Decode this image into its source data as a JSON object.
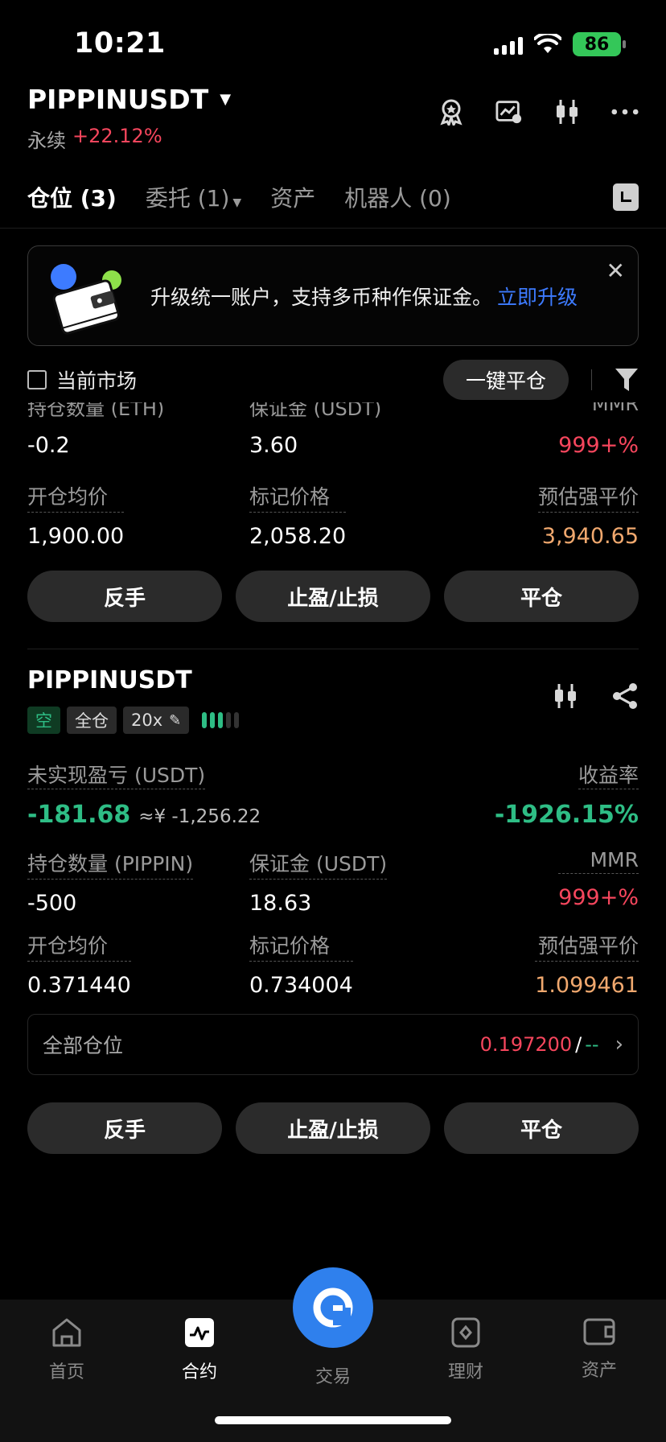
{
  "status_bar": {
    "time": "10:21",
    "battery": "86"
  },
  "header": {
    "pair": "PIPPINUSDT",
    "market_type": "永续",
    "change": "+22.12%"
  },
  "tabs": [
    {
      "label": "仓位 (3)"
    },
    {
      "label": "委托 (1)"
    },
    {
      "label": "资产"
    },
    {
      "label": "机器人 (0)"
    }
  ],
  "banner": {
    "text": "升级统一账户，支持多币种作保证金。",
    "link": "立即升级"
  },
  "filter": {
    "current_market": "当前市场",
    "close_all": "一键平仓"
  },
  "position1": {
    "cut_labels": [
      "持仓数量 (ETH)",
      "保证金 (USDT)",
      "MMR"
    ],
    "qty": "-0.2",
    "margin": "3.60",
    "mmr": "999+%",
    "entry_label": "开仓均价",
    "entry": "1,900.00",
    "mark_label": "标记价格",
    "mark": "2,058.20",
    "liq_label": "预估强平价",
    "liq": "3,940.65",
    "buttons": [
      "反手",
      "止盈/止损",
      "平仓"
    ]
  },
  "position2": {
    "pair": "PIPPINUSDT",
    "side": "空",
    "margin_mode": "全仓",
    "leverage": "20x",
    "pnl_label": "未实现盈亏 (USDT)",
    "pnl": "-181.68",
    "pnl_cny": "≈¥ -1,256.22",
    "roe_label": "收益率",
    "roe": "-1926.15%",
    "qty_label": "持仓数量 (PIPPIN)",
    "qty": "-500",
    "margin_label": "保证金 (USDT)",
    "margin": "18.63",
    "mmr_label": "MMR",
    "mmr": "999+%",
    "entry_label": "开仓均价",
    "entry": "0.371440",
    "mark_label": "标记价格",
    "mark": "0.734004",
    "liq_label": "预估强平价",
    "liq": "1.099461",
    "all_positions_label": "全部仓位",
    "all_positions_liq": "0.197200",
    "all_positions_sep": "/",
    "all_positions_dash": "--",
    "buttons": [
      "反手",
      "止盈/止损",
      "平仓"
    ]
  },
  "bottom_nav": [
    {
      "label": "首页",
      "icon": "home-icon"
    },
    {
      "label": "合约",
      "icon": "futures-icon"
    },
    {
      "label": "交易",
      "icon": "trade-icon"
    },
    {
      "label": "理财",
      "icon": "earn-icon"
    },
    {
      "label": "资产",
      "icon": "wallet-icon"
    }
  ],
  "colors": {
    "up": "#f6465d",
    "down": "#2ebd85",
    "accent": "#2f80ed",
    "liq": "#f0a86e"
  }
}
